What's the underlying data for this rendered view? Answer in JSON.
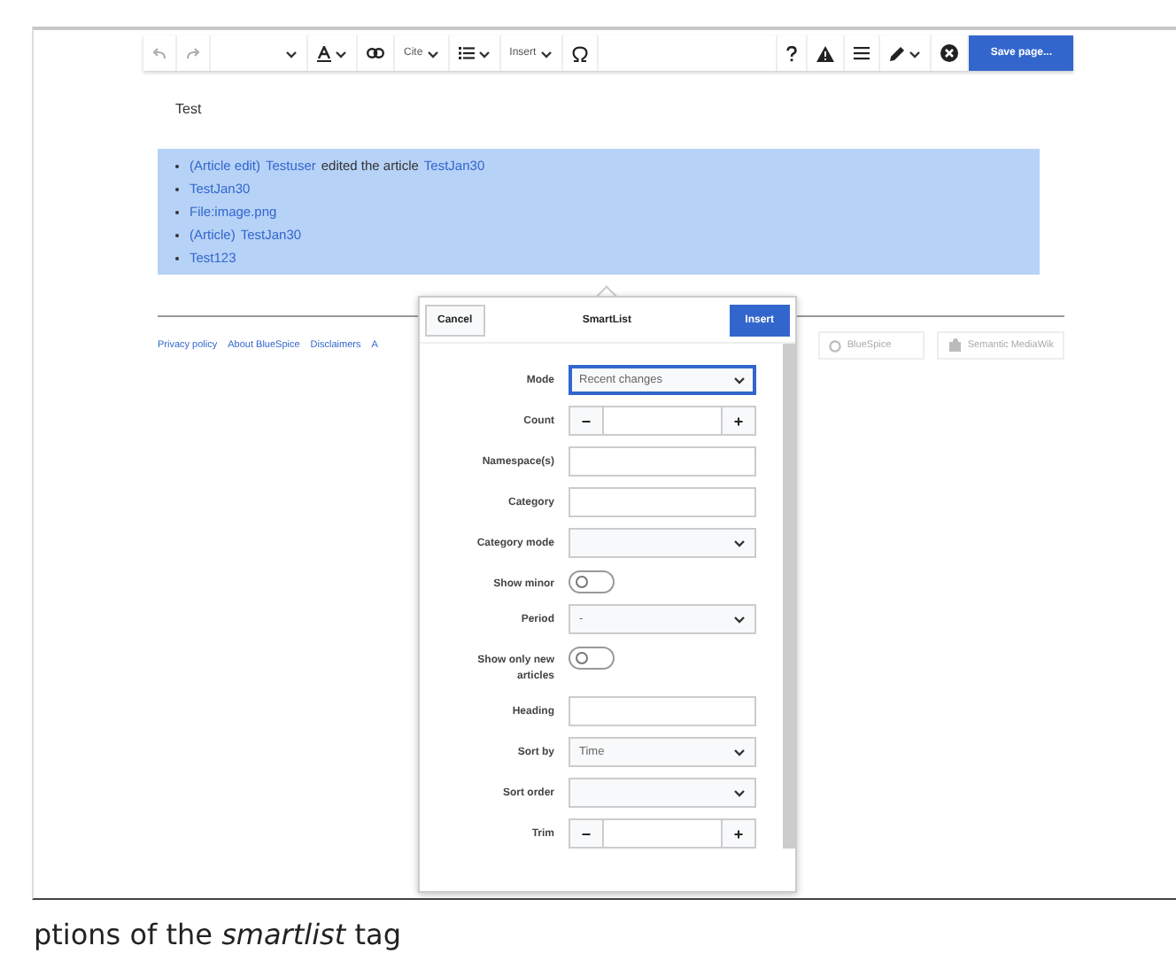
{
  "toolbar": {
    "items": [
      {
        "kind": "undo"
      },
      {
        "kind": "redo"
      },
      {
        "kind": "format"
      },
      {
        "kind": "style"
      },
      {
        "kind": "link"
      },
      {
        "kind": "menu",
        "label": "Cite"
      },
      {
        "kind": "list"
      },
      {
        "kind": "menu",
        "label": "Insert"
      },
      {
        "kind": "special"
      },
      {
        "kind": "spacer"
      },
      {
        "kind": "help"
      },
      {
        "kind": "notices"
      },
      {
        "kind": "hamburger"
      },
      {
        "kind": "edit"
      },
      {
        "kind": "close"
      }
    ],
    "save_button": "Save page..."
  },
  "article": {
    "text": "Test",
    "list": [
      {
        "parts": [
          {
            "text": "(Article edit)",
            "link": true
          },
          {
            "text": "Testuser",
            "link": true
          },
          {
            "text": "edited the article",
            "link": false
          },
          {
            "text": "TestJan30",
            "link": true
          }
        ]
      },
      {
        "parts": [
          {
            "text": "TestJan30",
            "link": true
          }
        ]
      },
      {
        "parts": [
          {
            "text": "File:image.png",
            "link": true
          }
        ]
      },
      {
        "parts": [
          {
            "text": "(Article)",
            "link": true
          },
          {
            "text": "TestJan30",
            "link": true
          }
        ]
      },
      {
        "parts": [
          {
            "text": "Test123",
            "link": true
          }
        ]
      }
    ]
  },
  "footer": {
    "links": [
      "Privacy policy",
      "About BlueSpice",
      "Disclaimers",
      "A"
    ],
    "badges": [
      {
        "kind": "bluespice",
        "label": "BlueSpice"
      },
      {
        "kind": "smw",
        "label": "Semantic MediaWik"
      }
    ]
  },
  "dialog": {
    "cancel": "Cancel",
    "title": "SmartList",
    "insert": "Insert",
    "fields": [
      {
        "kind": "dropdown",
        "label": "Mode",
        "value": "Recent changes",
        "focused": true
      },
      {
        "kind": "stepper",
        "label": "Count",
        "minus": "−",
        "plus": "+"
      },
      {
        "kind": "text",
        "label": "Namespace(s)"
      },
      {
        "kind": "text",
        "label": "Category"
      },
      {
        "kind": "dropdown",
        "label": "Category mode",
        "focused": false
      },
      {
        "kind": "toggle",
        "label": "Show minor",
        "on": false
      },
      {
        "kind": "dropdown",
        "label": "Period",
        "value": "-",
        "focused": false
      },
      {
        "kind": "toggle",
        "label": "Show only new articles",
        "on": false
      },
      {
        "kind": "text",
        "label": "Heading"
      },
      {
        "kind": "dropdown",
        "label": "Sort by",
        "value": "Time",
        "focused": false
      },
      {
        "kind": "dropdown",
        "label": "Sort order",
        "focused": false
      },
      {
        "kind": "stepper",
        "label": "Trim",
        "minus": "−",
        "plus": "+"
      }
    ]
  },
  "caption": "ptions of the *smartlist* tag"
}
